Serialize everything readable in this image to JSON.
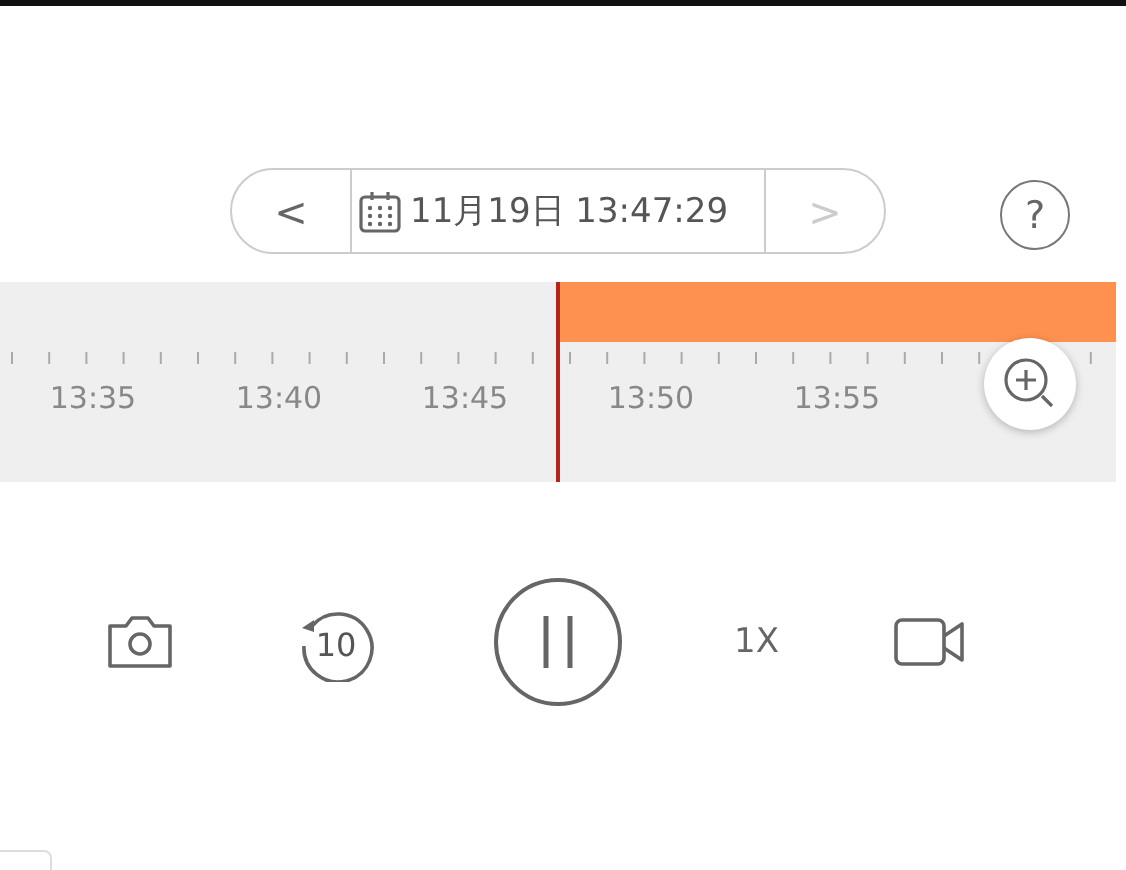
{
  "date_picker": {
    "prev": "<",
    "date": "11月19日 13:47:29",
    "next": ">",
    "next_disabled": true
  },
  "help": "?",
  "timeline": {
    "labels": [
      "13:35",
      "13:40",
      "13:45",
      "13:50",
      "13:55"
    ]
  },
  "controls": {
    "replay_seconds": "10",
    "playing": true,
    "speed": "1X"
  }
}
